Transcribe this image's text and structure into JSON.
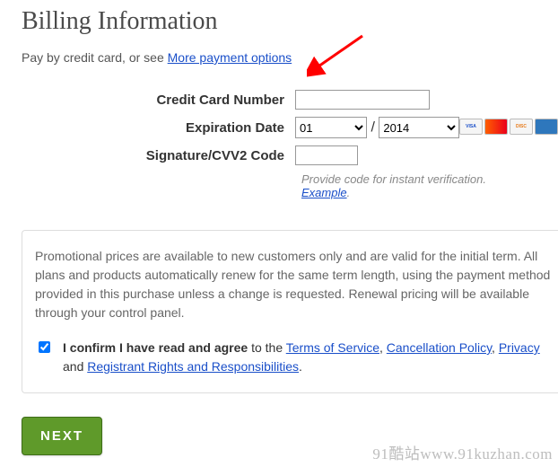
{
  "heading": "Billing Information",
  "subtext_prefix": "Pay by credit card, or see ",
  "subtext_link": "More payment options",
  "form": {
    "cc_label": "Credit Card Number",
    "cc_value": "",
    "exp_label": "Expiration Date",
    "exp_month": "01",
    "exp_year": "2014",
    "cvv_label": "Signature/CVV2 Code",
    "cvv_value": "",
    "hint_prefix": "Provide code for instant verification. ",
    "hint_link": "Example"
  },
  "card_icons": [
    "VISA",
    "MC",
    "DISC",
    "AMEX"
  ],
  "promo_text": "Promotional prices are available to new customers only and are valid for the initial term. All plans and products automatically renew for the same term length, using the payment method provided in this purchase unless a change is requested. Renewal pricing will be available through your control panel.",
  "agree": {
    "lead": "I confirm I have read and agree",
    "mid": " to the ",
    "tos": "Terms of Service",
    "cancel": "Cancellation Policy",
    "priv": "Privacy",
    "and": "and ",
    "reg": "Registrant Rights and Responsibilities",
    "checked": true
  },
  "next_label": "NEXT",
  "watermark": "91酷站www.91kuzhan.com"
}
